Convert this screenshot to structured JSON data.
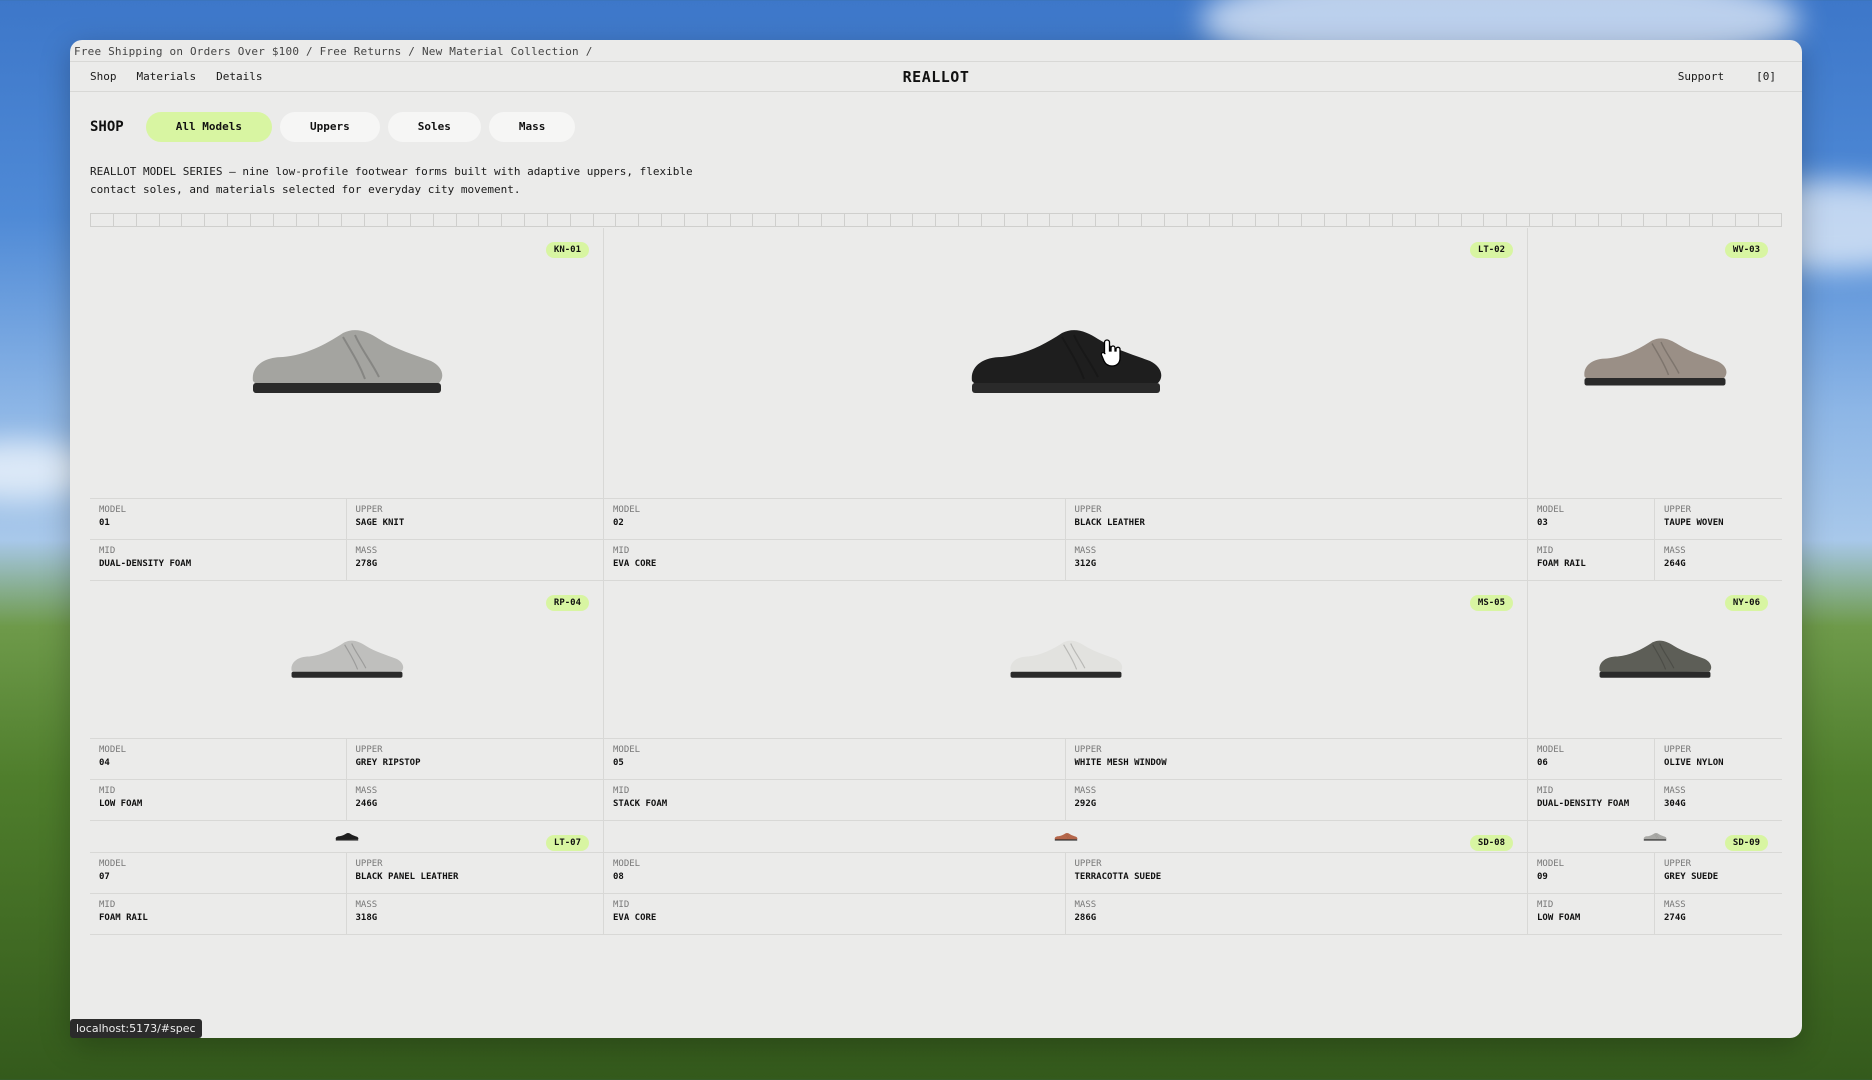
{
  "ticker": "Free Shipping on Orders Over $100 / Free Returns / New Material Collection /",
  "nav": {
    "left": [
      "Shop",
      "Materials",
      "Details"
    ],
    "brand": "REALLOT",
    "support": "Support",
    "cart": "[0]"
  },
  "shop": {
    "label": "SHOP",
    "filters": [
      "All Models",
      "Uppers",
      "Soles",
      "Mass"
    ],
    "active_filter": "All Models"
  },
  "intro": "REALLOT MODEL SERIES — nine low-profile footwear forms built with adaptive uppers, flexible contact soles, and materials selected for everyday city movement.",
  "spec_labels": {
    "model": "MODEL",
    "upper": "UPPER",
    "mid": "MID",
    "mass": "MASS"
  },
  "products": [
    {
      "tag": "KN-01",
      "model": "01",
      "upper": "SAGE KNIT",
      "mid": "DUAL-DENSITY FOAM",
      "mass": "278G",
      "color": "#a4a4a0"
    },
    {
      "tag": "LT-02",
      "model": "02",
      "upper": "BLACK LEATHER",
      "mid": "EVA CORE",
      "mass": "312G",
      "color": "#1e1e1e"
    },
    {
      "tag": "WV-03",
      "model": "03",
      "upper": "TAUPE WOVEN",
      "mid": "FOAM RAIL",
      "mass": "264G",
      "color": "#9a8f86"
    },
    {
      "tag": "RP-04",
      "model": "04",
      "upper": "GREY RIPSTOP",
      "mid": "LOW FOAM",
      "mass": "246G",
      "color": "#bfbfbd"
    },
    {
      "tag": "MS-05",
      "model": "05",
      "upper": "WHITE MESH WINDOW",
      "mid": "STACK FOAM",
      "mass": "292G",
      "color": "#e2e2df"
    },
    {
      "tag": "NY-06",
      "model": "06",
      "upper": "OLIVE NYLON",
      "mid": "DUAL-DENSITY FOAM",
      "mass": "304G",
      "color": "#5d5e57"
    },
    {
      "tag": "LT-07",
      "model": "07",
      "upper": "BLACK PANEL LEATHER",
      "mid": "FOAM RAIL",
      "mass": "318G",
      "color": "#1e1e1e"
    },
    {
      "tag": "SD-08",
      "model": "08",
      "upper": "TERRACOTTA SUEDE",
      "mid": "EVA CORE",
      "mass": "286G",
      "color": "#b5664a"
    },
    {
      "tag": "SD-09",
      "model": "09",
      "upper": "GREY SUEDE",
      "mid": "LOW FOAM",
      "mass": "274G",
      "color": "#a9a9a6"
    }
  ],
  "status_url": "localhost:5173/#spec"
}
